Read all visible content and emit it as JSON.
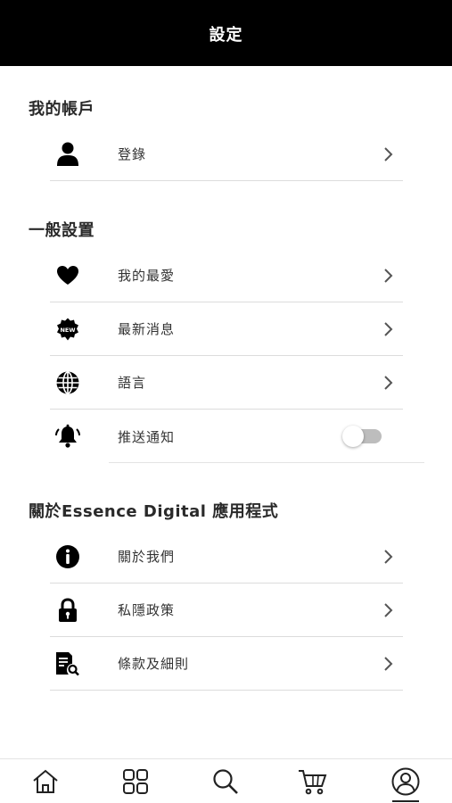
{
  "header": {
    "title": "設定"
  },
  "sections": {
    "account": {
      "title": "我的帳戶",
      "items": [
        {
          "label": "登錄",
          "icon": "user-icon"
        }
      ]
    },
    "general": {
      "title": "一般設置",
      "items": [
        {
          "label": "我的最愛",
          "icon": "heart-icon"
        },
        {
          "label": "最新消息",
          "icon": "new-badge-icon",
          "badge_text": "NEW"
        },
        {
          "label": "語言",
          "icon": "globe-icon"
        },
        {
          "label": "推送通知",
          "icon": "bell-icon",
          "toggle_on": false
        }
      ]
    },
    "about": {
      "title": "關於Essence Digital 應用程式",
      "items": [
        {
          "label": "關於我們",
          "icon": "info-icon"
        },
        {
          "label": "私隱政策",
          "icon": "lock-icon"
        },
        {
          "label": "條款及細則",
          "icon": "document-search-icon"
        }
      ]
    }
  },
  "bottom_nav": {
    "items": [
      {
        "icon": "home-icon",
        "active": false
      },
      {
        "icon": "grid-icon",
        "active": false
      },
      {
        "icon": "search-icon",
        "active": false
      },
      {
        "icon": "cart-icon",
        "active": false
      },
      {
        "icon": "profile-icon",
        "active": true
      }
    ]
  },
  "colors": {
    "header_bg": "#000000",
    "text": "#222222",
    "divider": "#dcdcdc",
    "toggle_off": "#bdbdbd"
  }
}
